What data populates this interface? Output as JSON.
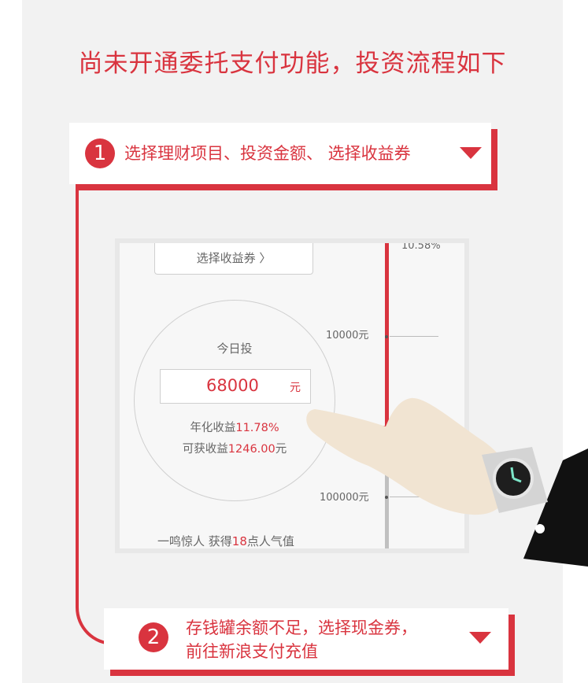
{
  "headline": "尚未开通委托支付功能，投资流程如下",
  "steps": [
    {
      "number": "1",
      "text": "选择理财项目、投资金额、 选择收益券"
    },
    {
      "number": "2",
      "line1": "存钱罐余额不足，选择现金券，",
      "line2": "前往新浪支付充值"
    }
  ],
  "phone": {
    "coupon_label": "选择收益券 〉",
    "today_label": "今日投",
    "amount_value": "68000",
    "amount_unit": "元",
    "rate_prefix": "年化收益",
    "rate_value": "11.78%",
    "earn_prefix": "可获收益",
    "earn_value": "1246.00",
    "earn_unit": "元",
    "tip_prefix": "一鸣惊人 获得",
    "tip_value": "18",
    "tip_suffix": "点人气值",
    "scale_top_label": "10.58%",
    "scale_label_1": "10000元",
    "scale_label_2": "100000元"
  },
  "colors": {
    "accent": "#d9343f",
    "panel": "#f2f2f2",
    "skin": "#f1e4d2"
  }
}
